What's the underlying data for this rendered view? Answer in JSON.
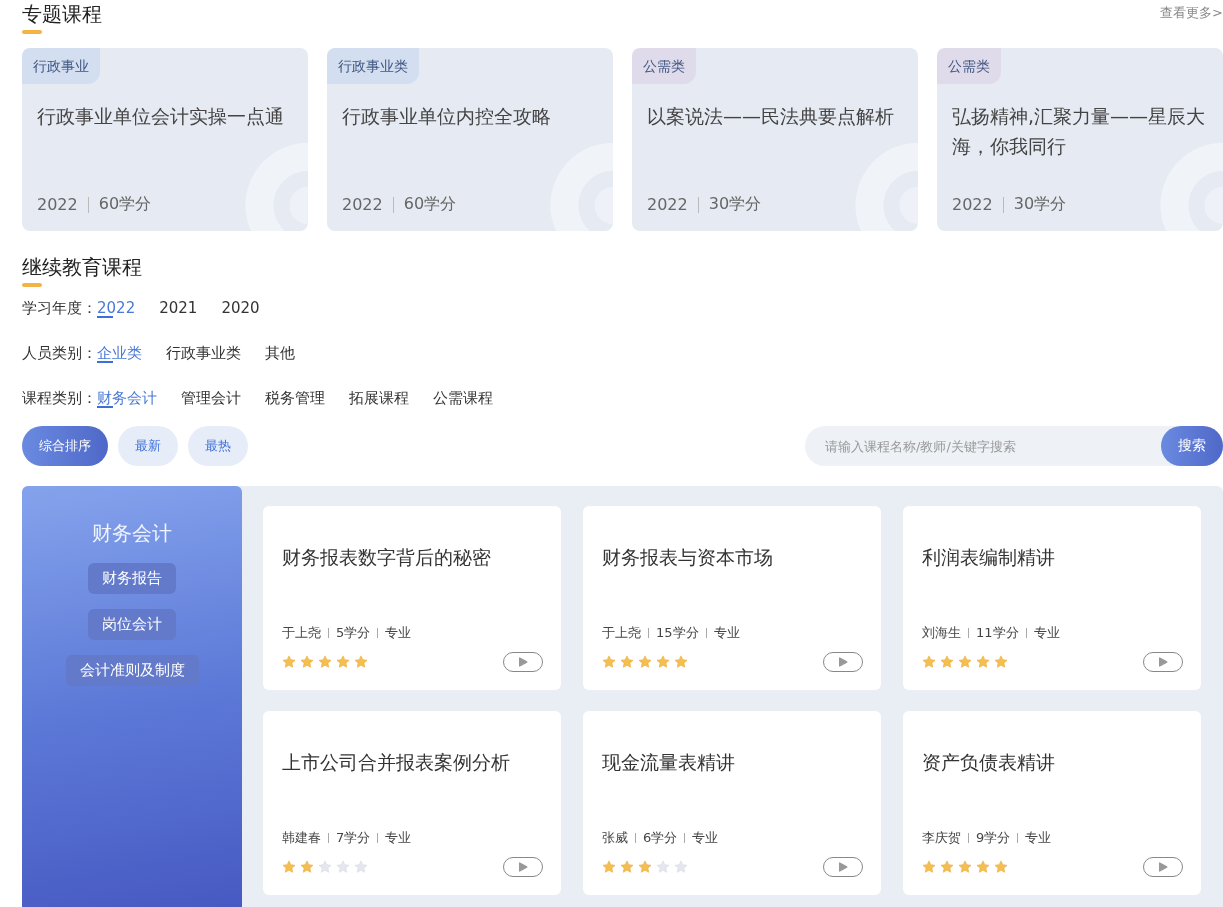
{
  "featured": {
    "title": "专题课程",
    "more_link": "查看更多>",
    "cards": [
      {
        "tag": "行政事业",
        "color": "#d3def1",
        "title": "行政事业单位会计实操一点通",
        "year": "2022",
        "credits": "60学分"
      },
      {
        "tag": "行政事业类",
        "color": "#d3def1",
        "title": "行政事业单位内控全攻略",
        "year": "2022",
        "credits": "60学分"
      },
      {
        "tag": "公需类",
        "color": "#e0dbeb",
        "title": "以案说法——民法典要点解析",
        "year": "2022",
        "credits": "30学分"
      },
      {
        "tag": "公需类",
        "color": "#e0dbeb",
        "title": "弘扬精神,汇聚力量——星辰大海，你我同行",
        "year": "2022",
        "credits": "30学分"
      }
    ]
  },
  "continuing": {
    "title": "继续教育课程",
    "filters": [
      {
        "label": "学习年度：",
        "options": [
          {
            "label": "2022",
            "selected": true
          },
          {
            "label": "2021",
            "selected": false
          },
          {
            "label": "2020",
            "selected": false
          }
        ]
      },
      {
        "label": "人员类别：",
        "options": [
          {
            "label": "企业类",
            "selected": true
          },
          {
            "label": "行政事业类",
            "selected": false
          },
          {
            "label": "其他",
            "selected": false
          }
        ]
      },
      {
        "label": "课程类别：",
        "options": [
          {
            "label": "财务会计",
            "selected": true
          },
          {
            "label": "管理会计",
            "selected": false
          },
          {
            "label": "税务管理",
            "selected": false
          },
          {
            "label": "拓展课程",
            "selected": false
          },
          {
            "label": "公需课程",
            "selected": false
          }
        ]
      }
    ],
    "sort_buttons": [
      {
        "label": "综合排序",
        "selected": true
      },
      {
        "label": "最新",
        "selected": false
      },
      {
        "label": "最热",
        "selected": false
      }
    ],
    "search": {
      "placeholder": "请输入课程名称/教师/关键字搜索",
      "button": "搜索"
    },
    "category_panel": {
      "title": "财务会计",
      "items": [
        "财务报告",
        "岗位会计",
        "会计准则及制度"
      ]
    },
    "courses": [
      {
        "title": "财务报表数字背后的秘密",
        "teacher": "于上尧",
        "credits": "5学分",
        "type": "专业",
        "stars": 5
      },
      {
        "title": "财务报表与资本市场",
        "teacher": "于上尧",
        "credits": "15学分",
        "type": "专业",
        "stars": 5
      },
      {
        "title": "利润表编制精讲",
        "teacher": "刘海生",
        "credits": "11学分",
        "type": "专业",
        "stars": 5
      },
      {
        "title": "上市公司合并报表案例分析",
        "teacher": "韩建春",
        "credits": "7学分",
        "type": "专业",
        "stars": 2
      },
      {
        "title": "现金流量表精讲",
        "teacher": "张威",
        "credits": "6学分",
        "type": "专业",
        "stars": 3
      },
      {
        "title": "资产负债表精讲",
        "teacher": "李庆贺",
        "credits": "9学分",
        "type": "专业",
        "stars": 5
      }
    ]
  }
}
